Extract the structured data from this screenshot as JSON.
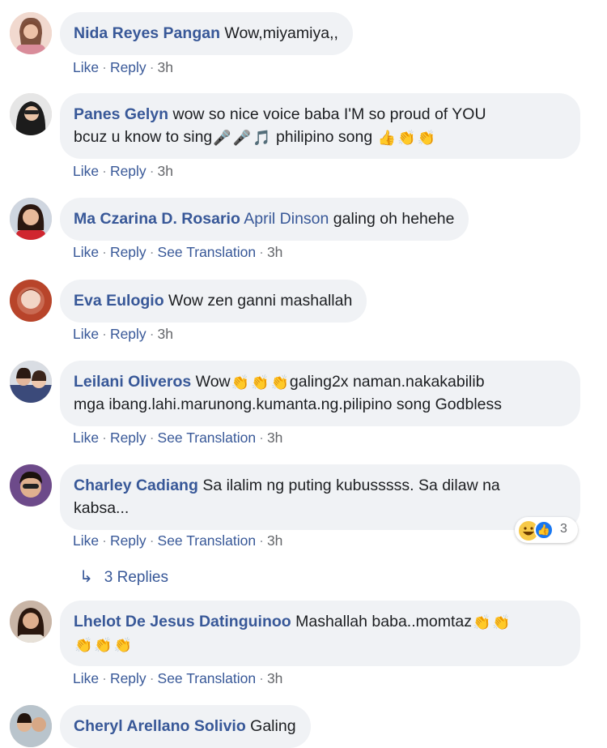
{
  "comments": [
    {
      "author": "Nida Reyes Pangan",
      "text": "Wow,miyamiya,,",
      "actions": [
        "Like",
        "Reply"
      ],
      "time": "3h"
    },
    {
      "author": "Panes Gelyn",
      "text_line1": "wow so nice voice baba I'M so proud of YOU",
      "text_line2a": "bcuz u know to sing",
      "text_line2b": "philipino song",
      "emojis_a": [
        "microphone-emoji",
        "microphone-emoji",
        "music-note-emoji"
      ],
      "emojis_b": [
        "thumbs-up-emoji",
        "clapping-hands-emoji",
        "clapping-hands-emoji"
      ],
      "actions": [
        "Like",
        "Reply"
      ],
      "time": "3h"
    },
    {
      "author": "Ma Czarina D. Rosario",
      "mention": "April Dinson",
      "text": "galing oh hehehe",
      "actions": [
        "Like",
        "Reply",
        "See Translation"
      ],
      "time": "3h"
    },
    {
      "author": "Eva Eulogio",
      "text": "Wow zen ganni mashallah",
      "actions": [
        "Like",
        "Reply"
      ],
      "time": "3h"
    },
    {
      "author": "Leilani Oliveros",
      "text_line1a": "Wow",
      "text_line1b": "galing2x naman.nakakabilib",
      "text_line2": "mga ibang.lahi.marunong.kumanta.ng.pilipino song Godbless",
      "emojis": [
        "clapping-hands-emoji",
        "clapping-hands-emoji",
        "clapping-hands-emoji"
      ],
      "actions": [
        "Like",
        "Reply",
        "See Translation"
      ],
      "time": "3h"
    },
    {
      "author": "Charley Cadiang",
      "text_line1": "Sa ilalim ng puting kubusssss. Sa dilaw na",
      "text_line2": "kabsa...",
      "actions": [
        "Like",
        "Reply",
        "See Translation"
      ],
      "time": "3h",
      "reactions": {
        "icons": [
          "haha-reaction-icon",
          "like-reaction-icon"
        ],
        "count": "3"
      },
      "replies_label": "3 Replies"
    },
    {
      "author": "Lhelot De Jesus Datinguinoo",
      "text": "Mashallah baba..momtaz",
      "emojis_line1": [
        "clapping-hands-emoji",
        "clapping-hands-emoji"
      ],
      "emojis_line2": [
        "clapping-hands-emoji",
        "clapping-hands-emoji",
        "clapping-hands-emoji"
      ],
      "actions": [
        "Like",
        "Reply",
        "See Translation"
      ],
      "time": "3h"
    },
    {
      "author": "Cheryl Arellano Solivio",
      "text": "Galing"
    }
  ],
  "colors": {
    "link": "#385898",
    "bubble": "#f0f2f5",
    "meta": "#65676b"
  }
}
